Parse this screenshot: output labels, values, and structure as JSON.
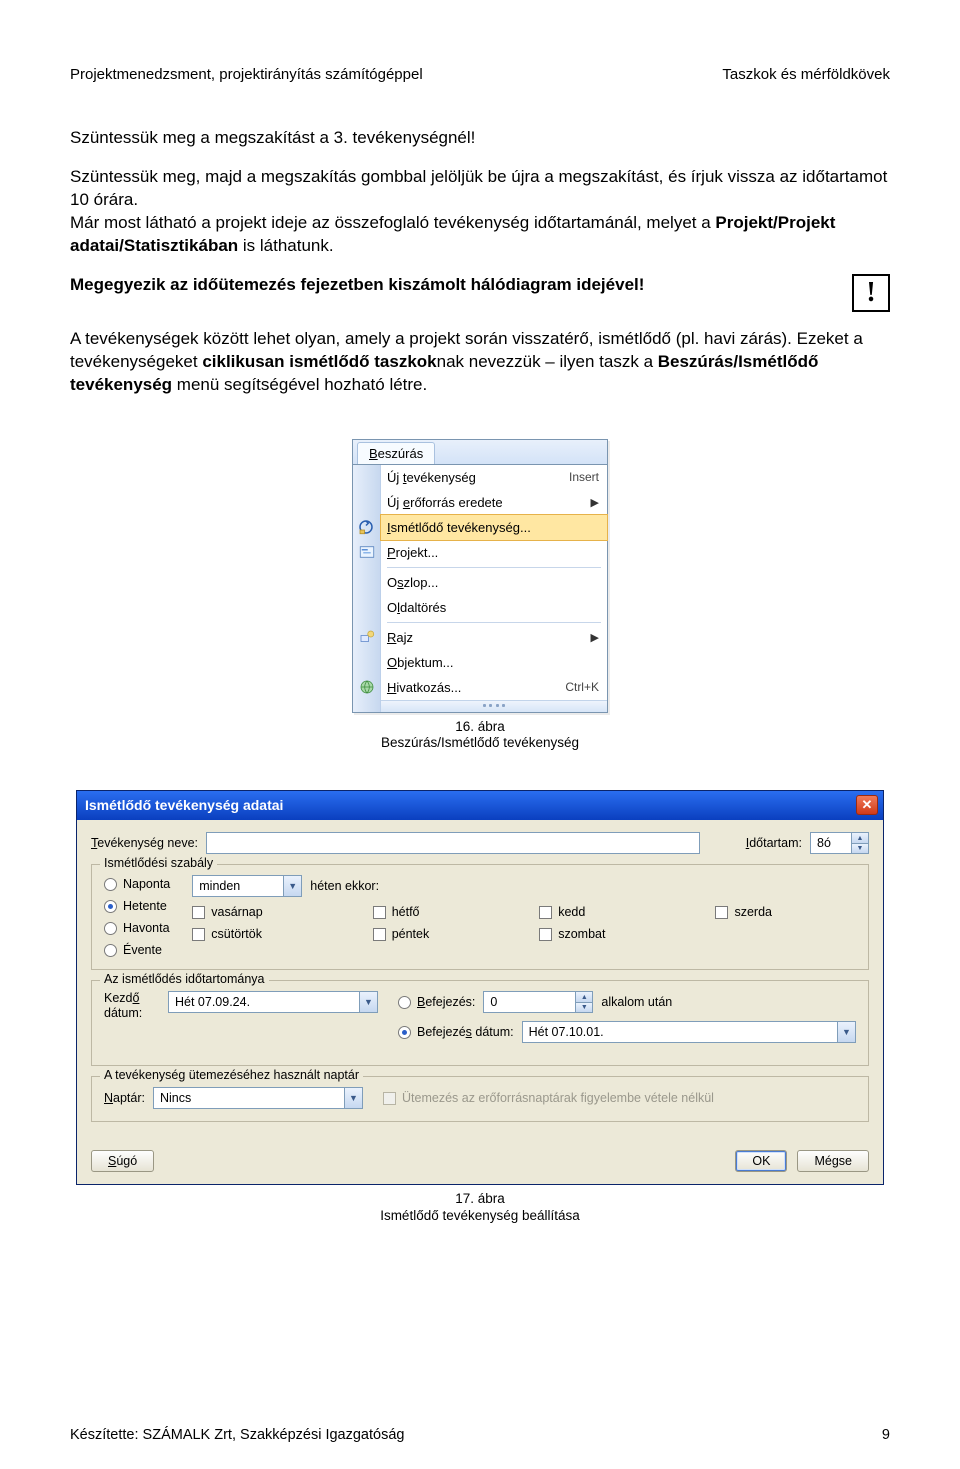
{
  "header": {
    "left": "Projektmenedzsment, projektirányítás számítógéppel",
    "right": "Taszkok és mérföldkövek"
  },
  "body": {
    "p1": "Szüntessük meg a megszakítást a 3. tevékenységnél!",
    "p2a": "Szüntessük meg, majd a megszakítás gombbal jelöljük be újra a megszakítást, és írjuk vissza az időtartamot 10 órára.",
    "p2b_pre": "Már most látható a projekt ideje az összefoglaló tevékenység időtartamánál, melyet a ",
    "p2b_bold": "Projekt/Projekt adatai/Statisztikában",
    "p2b_post": " is láthatunk.",
    "p3": "Megegyezik az időütemezés fejezetben kiszámolt hálódiagram idejével!",
    "p4_pre": "A tevékenységek között lehet olyan, amely a projekt során visszatérő, ismétlődő (pl. havi zárás). Ezeket a tevékenységeket ",
    "p4_b1": "ciklikusan ismétlődő taszkok",
    "p4_mid": "nak nevezzük – ilyen taszk a ",
    "p4_b2": "Beszúrás/Ismétlődő tevékenység",
    "p4_post": " menü segítségével hozható létre."
  },
  "exclaim": "!",
  "menu": {
    "title_u": "B",
    "title_rest": "eszúrás",
    "items": [
      {
        "u": "t",
        "pre": "Új ",
        "post": "evékenység",
        "shortcut": "Insert",
        "arrow": false,
        "icon": null,
        "hover": false
      },
      {
        "u": "e",
        "pre": "Új ",
        "post": "rőforrás eredete",
        "shortcut": "",
        "arrow": true,
        "icon": null,
        "hover": false
      },
      {
        "u": "I",
        "pre": "",
        "post": "smétlődő tevékenység...",
        "shortcut": "",
        "arrow": false,
        "icon": "recur",
        "hover": true
      },
      {
        "u": "P",
        "pre": "",
        "post": "rojekt...",
        "shortcut": "",
        "arrow": false,
        "icon": "proj",
        "hover": false
      }
    ],
    "items2": [
      {
        "u": "s",
        "pre": "O",
        "post": "zlop...",
        "shortcut": "",
        "arrow": false,
        "icon": null
      },
      {
        "u": "l",
        "pre": "O",
        "post": "daltörés",
        "shortcut": "",
        "arrow": false,
        "icon": null
      }
    ],
    "items3": [
      {
        "u": "R",
        "pre": "",
        "post": "ajz",
        "shortcut": "",
        "arrow": true,
        "icon": "draw"
      },
      {
        "u": "O",
        "pre": "",
        "post": "bjektum...",
        "shortcut": "",
        "arrow": false,
        "icon": null
      },
      {
        "u": "H",
        "pre": "",
        "post": "ivatkozás...",
        "shortcut": "Ctrl+K",
        "arrow": false,
        "icon": "link"
      }
    ]
  },
  "caption1_line1": "16. ábra",
  "caption1_line2": "Beszúrás/Ismétlődő tevékenység",
  "dialog": {
    "title": "Ismétlődő tevékenység adatai",
    "name_label_u": "T",
    "name_label_rest": "evékenység neve:",
    "duration_label_u": "I",
    "duration_label_rest": "dőtartam:",
    "duration_value": "8ó",
    "recurrence_legend": "Ismétlődési szabály",
    "freq": {
      "daily": "Naponta",
      "weekly": "Hetente",
      "monthly": "Havonta",
      "yearly": "Évente"
    },
    "every_value": "minden",
    "every_post": "héten ekkor:",
    "days": {
      "sun": "vasárnap",
      "mon": "hétfő",
      "tue": "kedd",
      "wed": "szerda",
      "thu": "csütörtök",
      "fri": "péntek",
      "sat": "szombat"
    },
    "range_legend": "Az ismétlődés időtartománya",
    "start_label_pre": "Kezd",
    "start_label_u": "ő",
    "start_label_post": " dátum:",
    "start_value": "Hét 07.09.24.",
    "end_after_label": "Befejezés:",
    "end_after_value": "0",
    "end_after_post": "alkalom után",
    "end_by_label_pre": "Befejezé",
    "end_by_label_u": "s",
    "end_by_label_post": " dátum:",
    "end_by_value": "Hét 07.10.01.",
    "calendar_legend": "A tevékenység ütemezéséhez használt naptár",
    "calendar_label": "Naptár:",
    "calendar_value": "Nincs",
    "calendar_opt": "Ütemezés az erőforrásnaptárak figyelembe vétele nélkül",
    "help": "Súgó",
    "ok": "OK",
    "cancel": "Mégse"
  },
  "caption2_line1": "17. ábra",
  "caption2_line2": "Ismétlődő tevékenység beállítása",
  "footer": {
    "left": "Készítette: SZÁMALK Zrt, Szakképzési Igazgatóság",
    "right": "9"
  }
}
